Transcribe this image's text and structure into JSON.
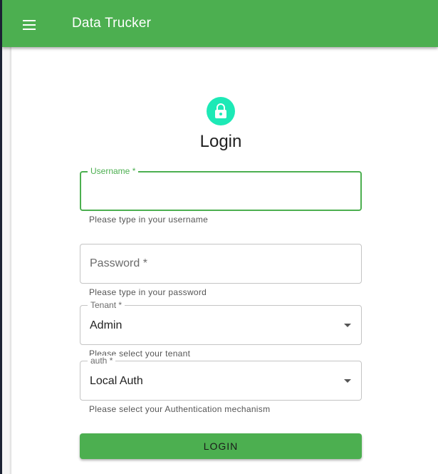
{
  "app": {
    "title": "Data Trucker"
  },
  "form": {
    "heading": "Login",
    "username": {
      "label": "Username *",
      "value": "",
      "helper": "Please type in your username"
    },
    "password": {
      "label": "Password *",
      "value": "",
      "helper": "Please type in your password"
    },
    "tenant": {
      "label": "Tenant *",
      "value": "Admin",
      "helper": "Please select your tenant"
    },
    "auth": {
      "label": "auth *",
      "value": "Local Auth",
      "helper": "Please select your Authentication mechanism"
    },
    "submit_label": "LOGIN"
  },
  "icons": {
    "menu": "menu-icon",
    "lock": "lock-icon",
    "dropdown": "arrow-drop-down-icon"
  },
  "colors": {
    "primary": "#4caf50",
    "avatar": "#1de9b6"
  }
}
